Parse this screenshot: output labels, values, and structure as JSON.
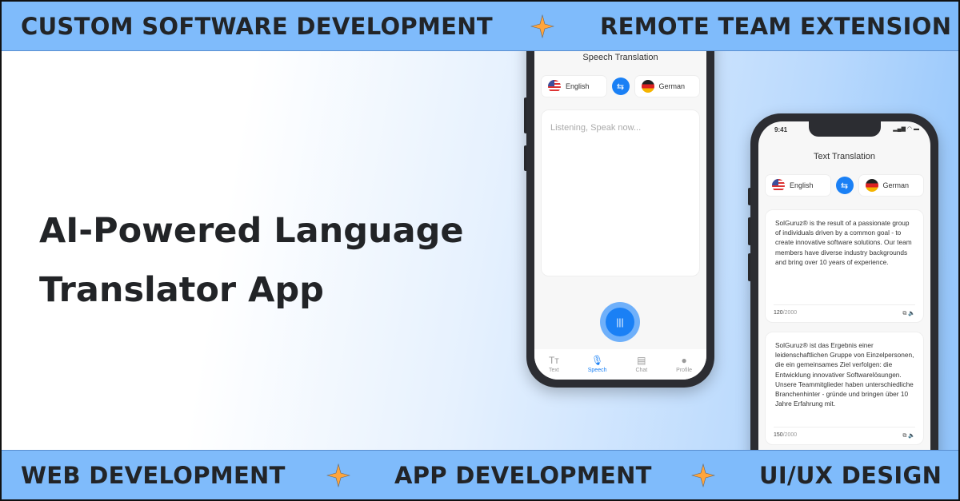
{
  "banners": {
    "top": [
      "CUSTOM SOFTWARE DEVELOPMENT",
      "REMOTE TEAM EXTENSION"
    ],
    "bottom": [
      "WEB DEVELOPMENT",
      "APP DEVELOPMENT",
      "UI/UX DESIGN"
    ],
    "background": "#7fbbfb",
    "star_color": "#ffa53c"
  },
  "headline": {
    "line1": "AI-Powered Language",
    "line2": "Translator App"
  },
  "speech_phone": {
    "title": "Speech Translation",
    "source_lang": "English",
    "target_lang": "German",
    "swap_icon": "swap-arrows-icon",
    "placeholder": "Listening, Speak now...",
    "mic_icon": "voice-wave-icon",
    "nav": [
      {
        "label": "Text",
        "icon": "text-size-icon"
      },
      {
        "label": "Speech",
        "icon": "microphone-icon",
        "active": true
      },
      {
        "label": "Chat",
        "icon": "chat-bubble-icon"
      },
      {
        "label": "Profile",
        "icon": "person-icon"
      }
    ]
  },
  "text_phone": {
    "time": "9:41",
    "title": "Text Translation",
    "source_lang": "English",
    "target_lang": "German",
    "source_text": "SolGuruz® is the result of a passionate group of individuals driven by a common goal - to create innovative software solutions. Our team members have diverse industry backgrounds and bring over 10 years of experience.",
    "source_count": "120",
    "source_max": "/2000",
    "target_text": "SolGuruz® ist das Ergebnis einer leidenschaftlichen Gruppe von Einzelpersonen, die ein gemeinsames Ziel verfolgen: die Entwicklung innovativer Softwarelösungen. Unsere Teammitglieder haben unterschiedliche Branchenhinter - gründe und bringen über 10 Jahre Erfahrung mit.",
    "target_count": "150",
    "target_max": "/2000",
    "accent": "#1a80f5"
  }
}
